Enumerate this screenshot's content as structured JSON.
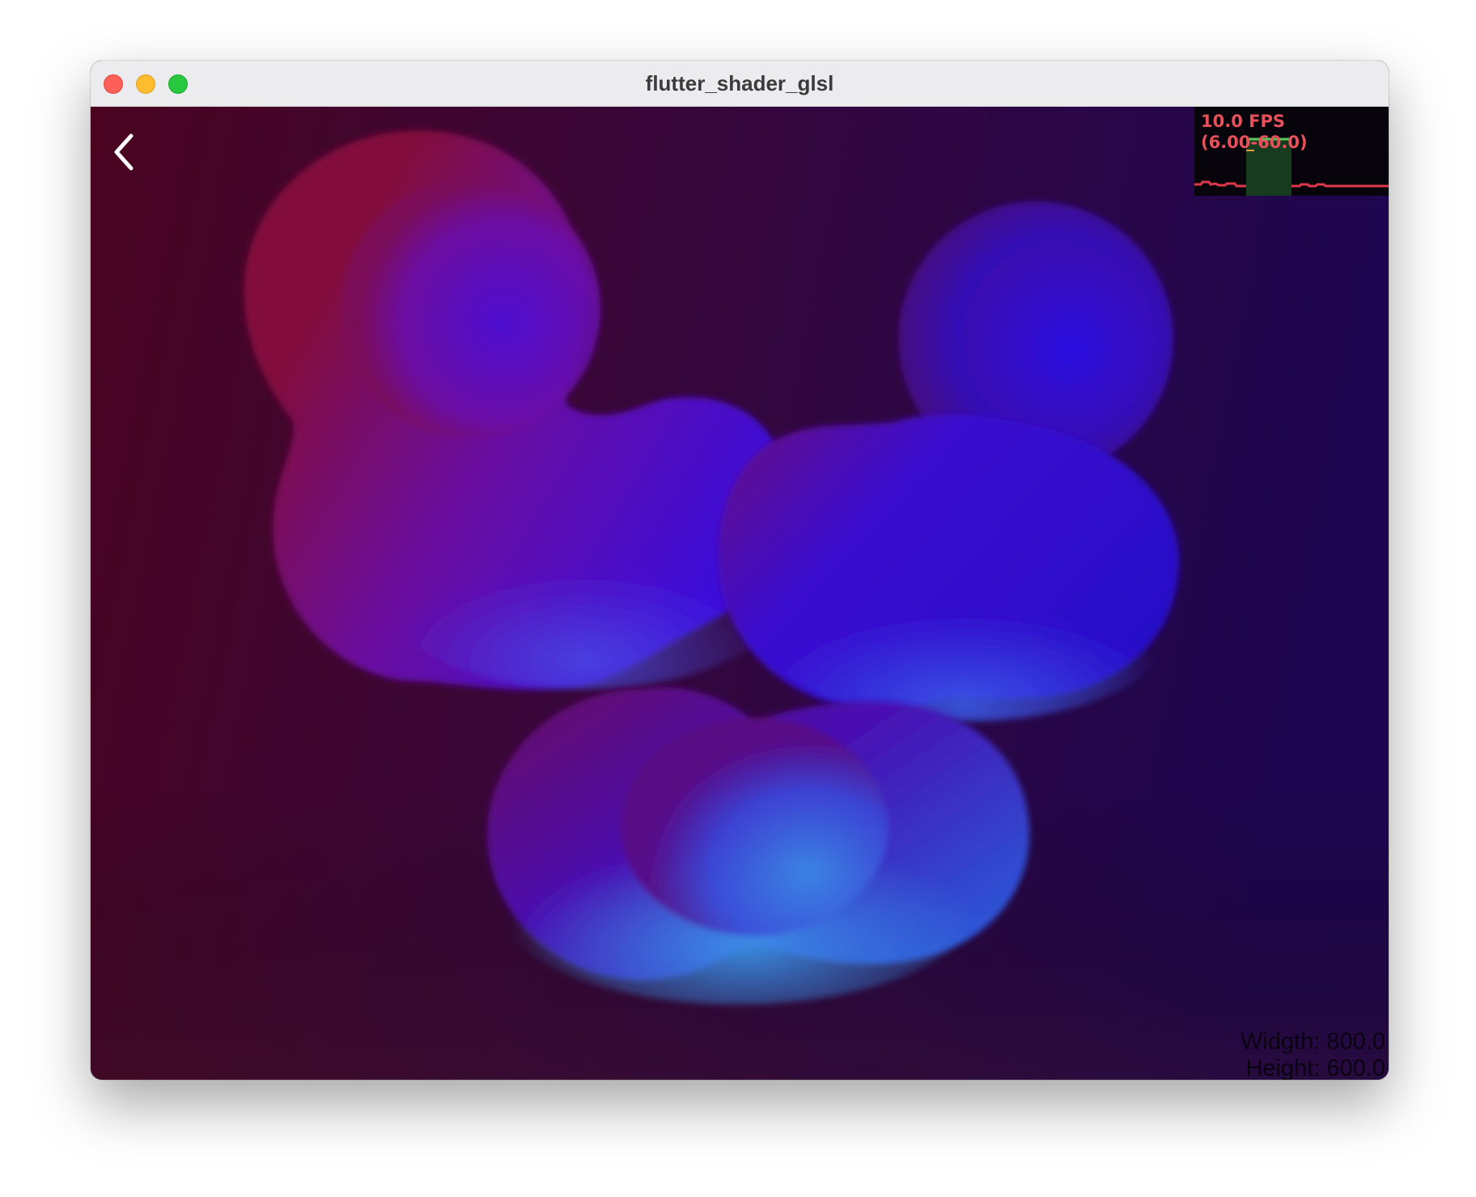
{
  "window": {
    "title": "flutter_shader_glsl"
  },
  "overlay": {
    "fps_line1": "10.0 FPS",
    "fps_line2": "(6.00-60.0)",
    "width_label": "Widgth: 800.0",
    "height_label": "Height: 600.0"
  },
  "icons": {
    "back": "chevron-left-icon"
  },
  "colors": {
    "bg_left": "#4a0420",
    "bg_right": "#1e0650",
    "blob_red": "#8a0a48",
    "blob_violet": "#4a08d0",
    "blob_blue": "#3560e6",
    "blob_cyan": "#3a9ae8",
    "fps_text": "#e8505a",
    "fps_good": "#5ac85a"
  }
}
